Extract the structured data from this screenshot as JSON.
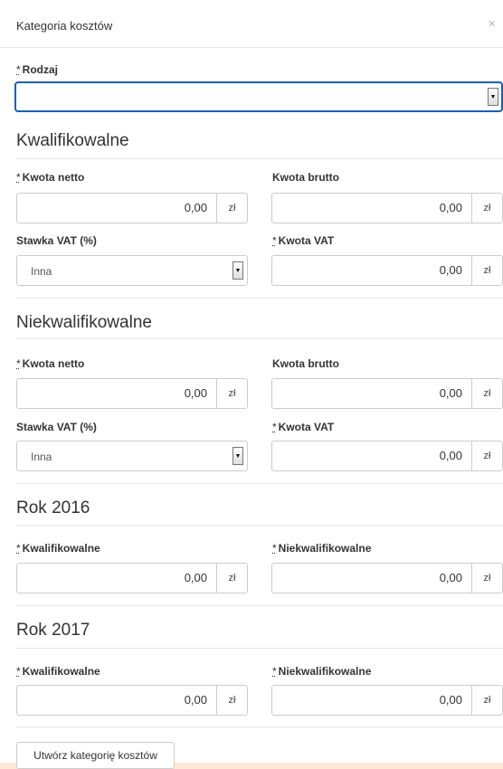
{
  "header": {
    "title": "Kategoria kosztów",
    "close_glyph": "×"
  },
  "rodzaj": {
    "label": "Rodzaj",
    "required_mark": "*"
  },
  "qualified": {
    "title": "Kwalifikowalne",
    "netto_label": "Kwota netto",
    "netto_value": "0,00",
    "brutto_label": "Kwota brutto",
    "brutto_value": "0,00",
    "vat_rate_label": "Stawka VAT (%)",
    "vat_rate_value": "Inna",
    "vat_label": "Kwota VAT",
    "vat_value": "0,00"
  },
  "nonqualified": {
    "title": "Niekwalifikowalne",
    "netto_label": "Kwota netto",
    "netto_value": "0,00",
    "brutto_label": "Kwota brutto",
    "brutto_value": "0,00",
    "vat_rate_label": "Stawka VAT (%)",
    "vat_rate_value": "Inna",
    "vat_label": "Kwota VAT",
    "vat_value": "0,00"
  },
  "year2016": {
    "title": "Rok 2016",
    "kwal_label": "Kwalifikowalne",
    "kwal_value": "0,00",
    "niekwal_label": "Niekwalifikowalne",
    "niekwal_value": "0,00"
  },
  "year2017": {
    "title": "Rok 2017",
    "kwal_label": "Kwalifikowalne",
    "kwal_value": "0,00",
    "niekwal_label": "Niekwalifikowalne",
    "niekwal_value": "0,00"
  },
  "currency": "zł",
  "required_mark": "*",
  "submit_label": "Utwórz kategorię kosztów",
  "icons": {
    "dropdown": "dropdown-arrow-icon",
    "close": "close-icon"
  },
  "colors": {
    "focus_border": "#1a5fb4",
    "page_bg": "#fce8d4"
  }
}
